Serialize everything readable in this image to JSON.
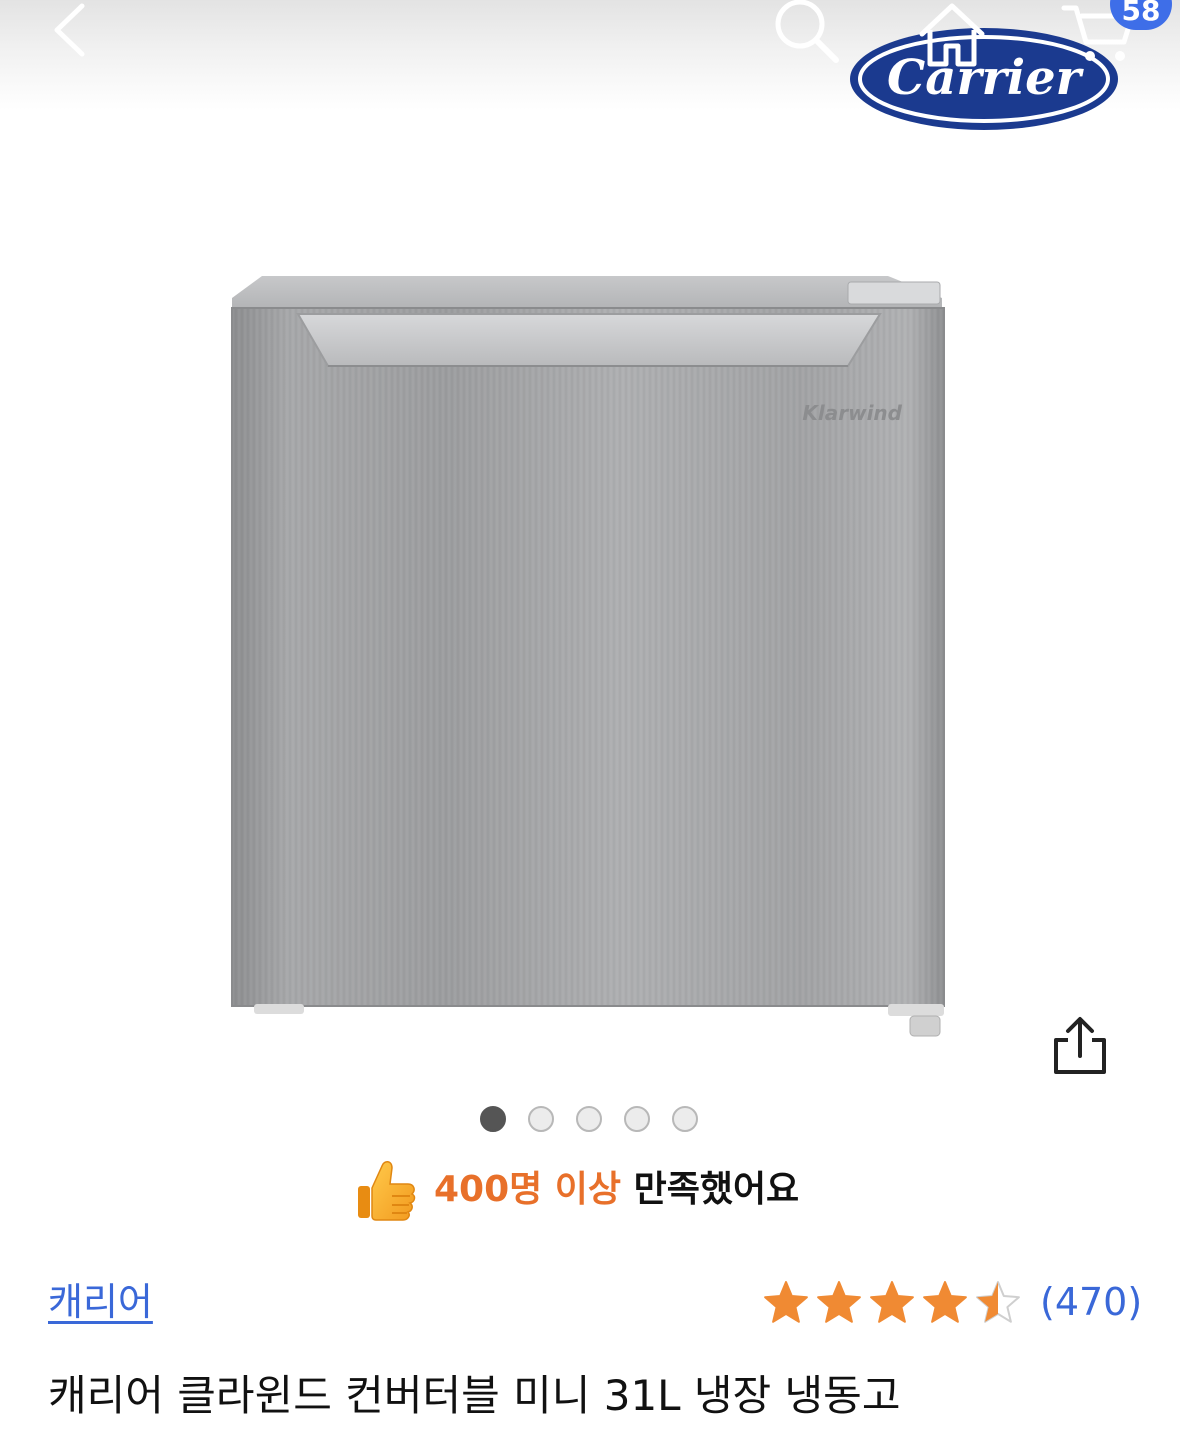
{
  "header": {
    "back_icon": "chevron-left-icon",
    "search_icon": "search-icon",
    "home_icon": "home-icon",
    "cart_icon": "cart-icon",
    "cart_badge": "58"
  },
  "brand_logo": {
    "text": "Carrier",
    "color": "#1b3a8f"
  },
  "product_image": {
    "subject": "mini refrigerator",
    "badge_text": "Klarwind"
  },
  "share": {
    "icon": "share-icon"
  },
  "carousel": {
    "total": 5,
    "active_index": 0
  },
  "satisfaction": {
    "icon": "thumbs-up-icon",
    "highlight": "400명 이상",
    "rest": " 만족했어요"
  },
  "brand": {
    "label": "캐리어"
  },
  "rating": {
    "value": 4.5,
    "max": 5,
    "count": "(470)",
    "star_color": "#f08a33"
  },
  "product": {
    "title": "캐리어 클라윈드 컨버터블 미니 31L 냉장 냉동고"
  },
  "colors": {
    "accent": "#3e6ee8",
    "highlight": "#e8702a",
    "link": "#3a68d8"
  }
}
